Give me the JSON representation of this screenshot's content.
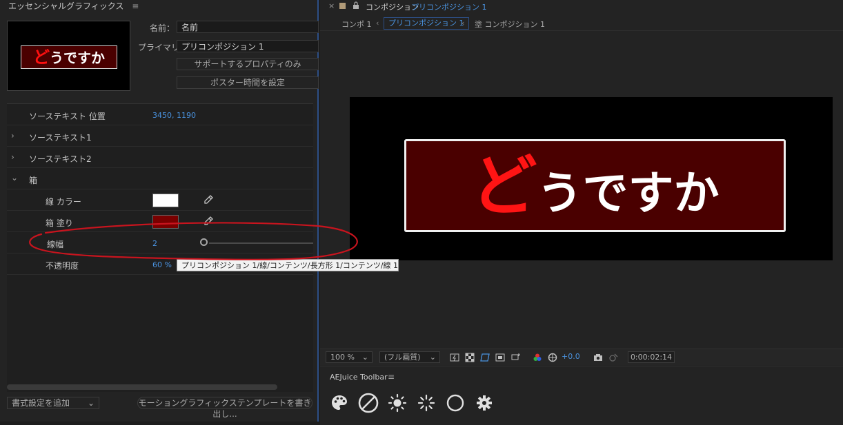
{
  "essential_graphics": {
    "title": "エッセンシャルグラフィックス",
    "menu_icon": "hamburger-icon",
    "thumbnail_text_red": "ど",
    "thumbnail_text_rest": "うですか",
    "name_label": "名前：",
    "name_value": "名前",
    "primary_label": "プライマリ：",
    "primary_value": "プリコンポジション 1",
    "supported_props_button": "サポートするプロパティのみ",
    "poster_time_button": "ポスター時間を設定",
    "properties": [
      {
        "name": "ソーステキスト 位置",
        "value": "3450, 1190"
      },
      {
        "name": "ソーステキスト1"
      },
      {
        "name": "ソーステキスト2"
      },
      {
        "name": "箱"
      },
      {
        "name": "線 カラー",
        "color": "#ffffff"
      },
      {
        "name": "箱 塗り",
        "color": "#7a0000"
      },
      {
        "name": "線幅",
        "value": "2"
      },
      {
        "name": "不透明度",
        "value": "60 %"
      }
    ],
    "tooltip": "プリコンポジション 1/線/コンテンツ/長方形 1/コンテンツ/線 1/線幅",
    "add_formatting": "書式設定を追加",
    "export_button": "モーショングラフィックステンプレートを書き出し..."
  },
  "composition": {
    "close_glyph": "×",
    "lock_icon": "lock-icon",
    "tab_prefix": "コンポジション",
    "tab_name": "プリコンポジション 1",
    "breadcrumbs": [
      "コンポ 1",
      "プリコンポジション 1",
      "塗 コンポジション 1"
    ],
    "viewer_text_red": "ど",
    "viewer_text_rest": "うですか",
    "box_fill": "#4a0000",
    "zoom": "100 %",
    "quality": "(フル画質)",
    "exposure": "+0.0",
    "timecode": "0:00:02:14"
  },
  "aejuice": {
    "title": "AEJuice Toolbar",
    "icons": [
      "palette-icon",
      "none-icon",
      "brightness-icon",
      "loading-icon",
      "circle-icon",
      "gear-icon"
    ]
  },
  "colors": {
    "accent_blue": "#4a93e0",
    "annotation_red": "#c8141e"
  }
}
